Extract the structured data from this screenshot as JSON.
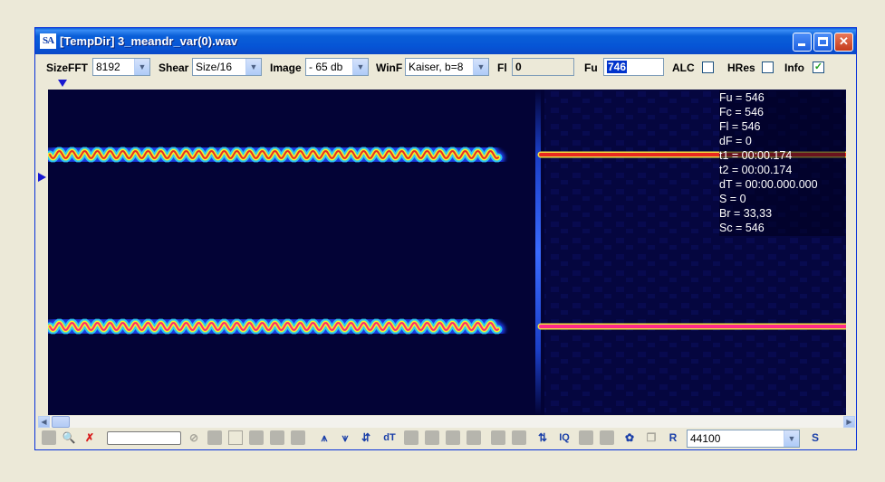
{
  "window": {
    "title": "[TempDir] 3_meandr_var(0).wav",
    "icon": "SA"
  },
  "toolbar": {
    "sizefft_label": "SizeFFT",
    "sizefft_value": "8192",
    "shear_label": "Shear",
    "shear_value": "Size/16",
    "image_label": "Image",
    "image_value": "- 65 db",
    "winf_label": "WinF",
    "winf_value": "Kaiser, b=8",
    "fl_label": "Fl",
    "fl_value": "0",
    "fu_label": "Fu",
    "fu_value": "746",
    "alc_label": "ALC",
    "alc_checked": false,
    "hres_label": "HRes",
    "hres_checked": false,
    "info_label": "Info",
    "info_checked": true
  },
  "info_panel": {
    "fu": "Fu = 546",
    "fc": "Fc = 546",
    "fl": "Fl = 546",
    "df": "dF = 0",
    "t1": "t1 = 00:00.174",
    "t2": "t2 = 00:00.174",
    "dt": "dT = 00:00.000.000",
    "s": "S = 0",
    "br": "Br = 33,33",
    "sc": "Sc = 546"
  },
  "bottombar": {
    "dt_label": "dT",
    "iq_label": "IQ",
    "r_label": "R",
    "s_label": "S",
    "samplerate_value": "44100"
  },
  "colors": {
    "spectro_bg": "#030336",
    "title_blue": "#0a5fd8",
    "selection": "#0033cc"
  },
  "icons": [
    "app-icon",
    "minimize-icon",
    "maximize-icon",
    "close-icon",
    "zoom-icon",
    "cancel-icon",
    "stop-icon",
    "arrow-icon",
    "recycle-icon"
  ]
}
